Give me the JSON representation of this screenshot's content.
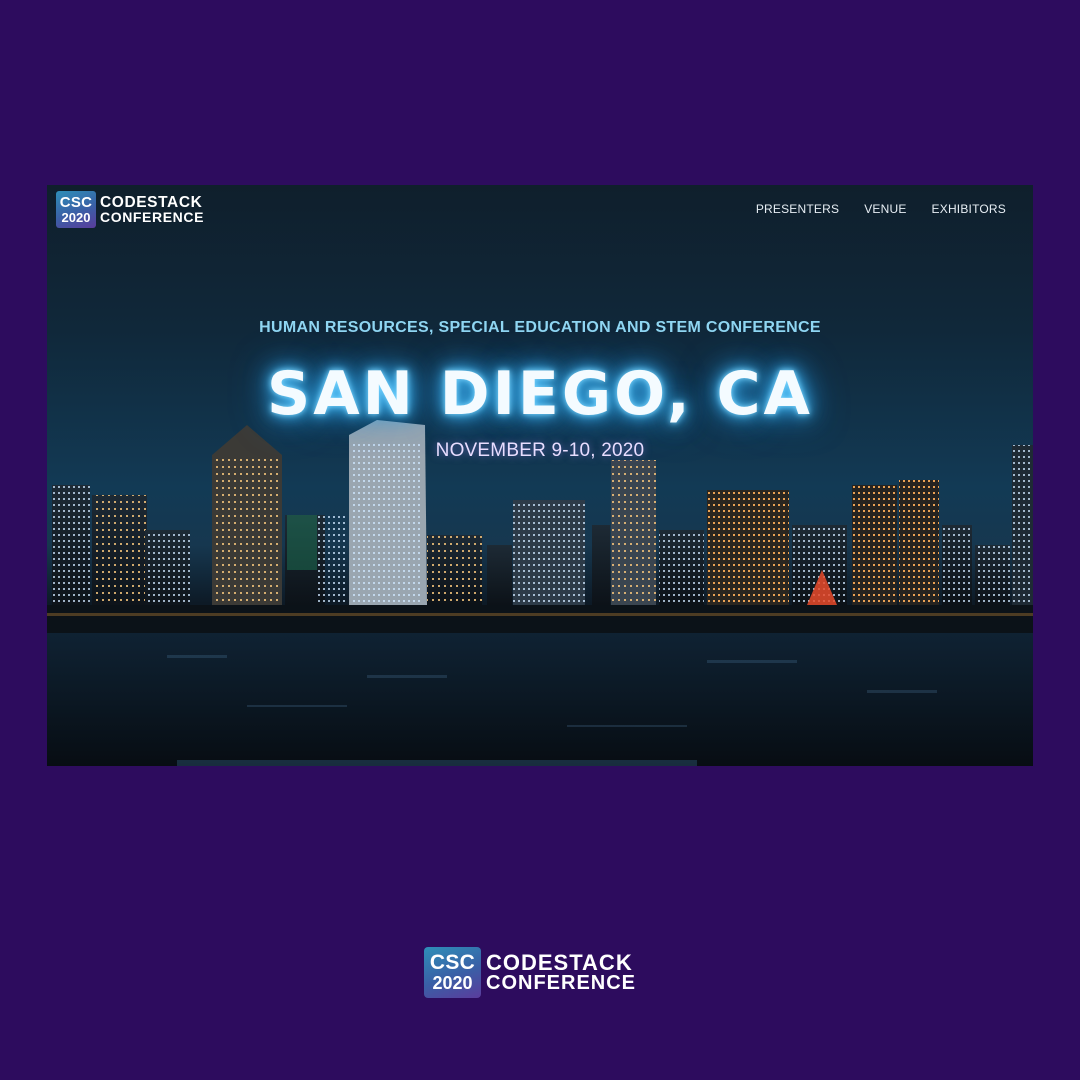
{
  "header": {
    "logo": {
      "badge_line1": "CSC",
      "badge_line2": "2020",
      "name_line1": "CODESTACK",
      "name_line2": "CONFERENCE"
    },
    "nav": [
      {
        "label": "PRESENTERS"
      },
      {
        "label": "VENUE"
      },
      {
        "label": "EXHIBITORS"
      }
    ]
  },
  "hero": {
    "subtitle": "HUMAN RESOURCES, SPECIAL EDUCATION AND STEM CONFERENCE",
    "headline": "SAN DIEGO, CA",
    "date": "NOVEMBER 9-10, 2020",
    "background": "night-city-skyline-image"
  },
  "footer": {
    "logo": {
      "badge_line1": "CSC",
      "badge_line2": "2020",
      "name_line1": "CODESTACK",
      "name_line2": "CONFERENCE"
    }
  },
  "colors": {
    "page_background": "#2d0c5e",
    "subtitle": "#8fd6f2",
    "headline_glow": "#4ec4ff",
    "badge_gradient_start": "#2e8fb8",
    "badge_gradient_end": "#5a3c9c"
  }
}
